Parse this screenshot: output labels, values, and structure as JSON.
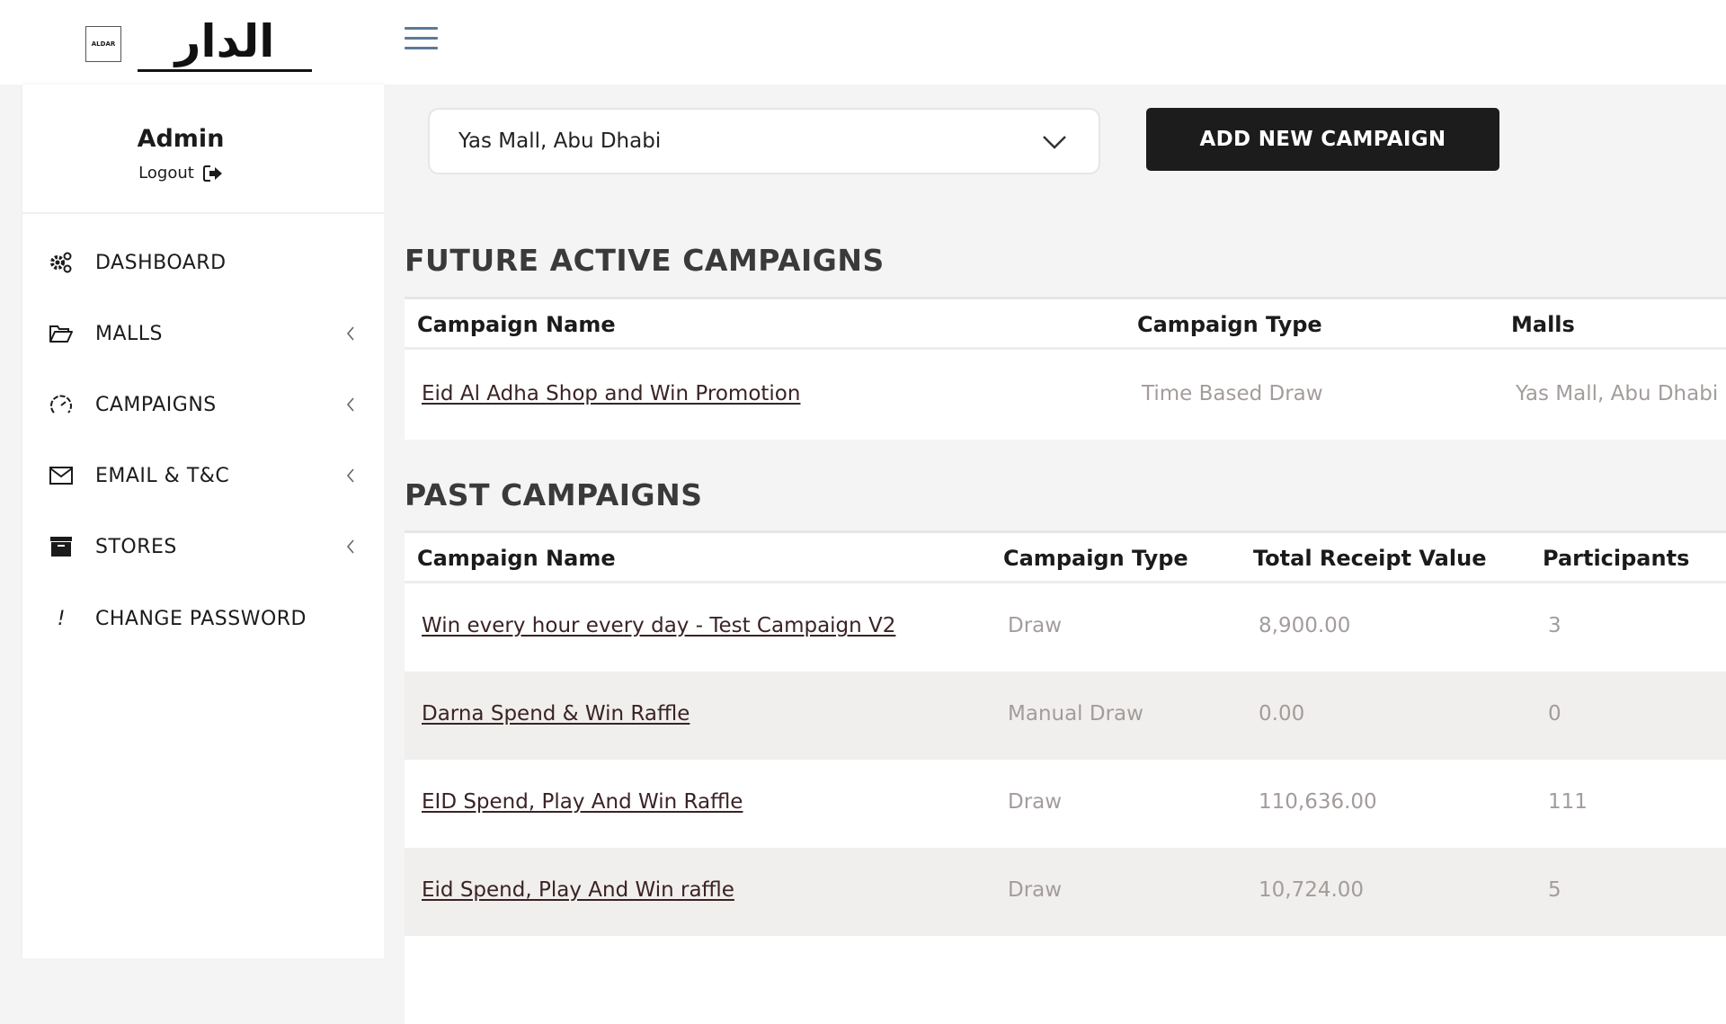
{
  "header": {
    "logo_badge_text": "ALDAR",
    "logo_wordmark": "الدار",
    "menu_icon": "hamburger-icon",
    "hamburger_color": "#5b7a99"
  },
  "user": {
    "name": "Admin",
    "logout_label": "Logout",
    "logout_icon": "sign-out-icon"
  },
  "sidebar": {
    "items": [
      {
        "label": "DASHBOARD",
        "icon": "gears-icon",
        "has_submenu": false
      },
      {
        "label": "MALLS",
        "icon": "folder-open-icon",
        "has_submenu": true
      },
      {
        "label": "CAMPAIGNS",
        "icon": "speedometer-icon",
        "has_submenu": true
      },
      {
        "label": "EMAIL & T&C",
        "icon": "envelope-icon",
        "has_submenu": true
      },
      {
        "label": "STORES",
        "icon": "archive-box-icon",
        "has_submenu": true
      },
      {
        "label": "CHANGE PASSWORD",
        "icon": "exclamation-icon",
        "has_submenu": false
      }
    ]
  },
  "toolbar": {
    "mall_select_value": "Yas Mall, Abu Dhabi",
    "add_campaign_label": "ADD NEW CAMPAIGN"
  },
  "future_campaigns": {
    "title": "FUTURE ACTIVE CAMPAIGNS",
    "columns": [
      "Campaign Name",
      "Campaign Type",
      "Malls"
    ],
    "rows": [
      {
        "name": "Eid Al Adha Shop and Win Promotion",
        "type": "Time Based Draw",
        "malls": "Yas Mall, Abu Dhabi"
      }
    ]
  },
  "past_campaigns": {
    "title": "PAST CAMPAIGNS",
    "columns": [
      "Campaign Name",
      "Campaign Type",
      "Total Receipt Value",
      "Participants"
    ],
    "rows": [
      {
        "name": "Win every hour every day - Test Campaign V2",
        "type": "Draw",
        "total": "8,900.00",
        "participants": "3"
      },
      {
        "name": "Darna Spend & Win Raffle",
        "type": "Manual Draw",
        "total": "0.00",
        "participants": "0"
      },
      {
        "name": "EID Spend, Play And Win Raffle",
        "type": "Draw",
        "total": "110,636.00",
        "participants": "111"
      },
      {
        "name": "Eid Spend, Play And Win raffle",
        "type": "Draw",
        "total": "10,724.00",
        "participants": "5"
      }
    ]
  },
  "colors": {
    "link": "#3b2325",
    "muted_cell": "#a39c9b",
    "button_bg": "#1c1c1c",
    "page_bg": "#f4f4f4",
    "alt_row": "#f0efed"
  }
}
